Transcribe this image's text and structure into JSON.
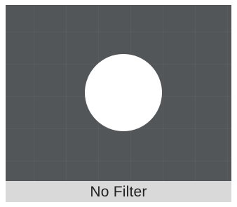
{
  "filter_preview": {
    "caption": "No Filter",
    "colors": {
      "preview_background": "#525659",
      "shape_fill": "#ffffff",
      "caption_bar": "#d9d9d9",
      "caption_text": "#222222"
    },
    "shape": "circle"
  }
}
